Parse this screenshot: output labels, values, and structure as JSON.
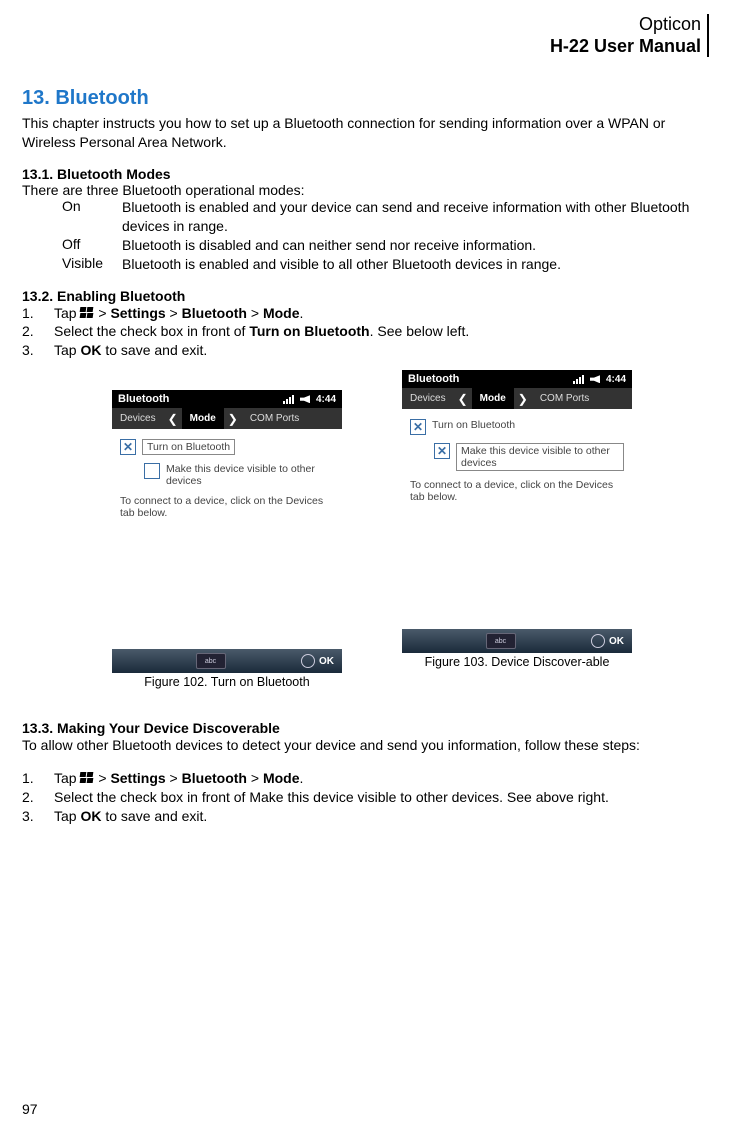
{
  "header": {
    "line1": "Opticon",
    "line2": "H-22 User Manual"
  },
  "chapter": {
    "title": "13. Bluetooth",
    "intro": "This chapter instructs you how to set up a Bluetooth connection for sending information over a WPAN or Wireless Personal Area Network."
  },
  "s1": {
    "head": "13.1. Bluetooth Modes",
    "intro": "There are three Bluetooth operational modes:",
    "modes": [
      {
        "label": "On",
        "desc": "Bluetooth is enabled and your device can send and receive information with other Bluetooth devices in range."
      },
      {
        "label": "Off",
        "desc": "Bluetooth is disabled and can neither send nor receive information."
      },
      {
        "label": "Visible",
        "desc": "Bluetooth is enabled and visible to all other Bluetooth devices in range."
      }
    ]
  },
  "s2": {
    "head": "13.2. Enabling Bluetooth",
    "step1_pre": "Tap ",
    "step1_post_a": " > ",
    "step1_b1": "Settings",
    "step1_post_b": " > ",
    "step1_b2": "Bluetooth",
    "step1_post_c": " > ",
    "step1_b3": "Mode",
    "step1_end": ".",
    "step2_pre": "Select the check box in front of ",
    "step2_b": "Turn on Bluetooth",
    "step2_post": ". See below left.",
    "step3_pre": "Tap ",
    "step3_b": "OK",
    "step3_post": " to save and exit."
  },
  "s3": {
    "head": "13.3. Making Your Device Discoverable",
    "intro": "To allow other Bluetooth devices to detect your device and send you information, follow these steps:",
    "step1_pre": "Tap ",
    "step1_post_a": " > ",
    "step1_b1": "Settings",
    "step1_post_b": " > ",
    "step1_b2": "Bluetooth",
    "step1_post_c": " > ",
    "step1_b3": "Mode",
    "step1_end": ".",
    "step2": "Select the check box in front of Make this device visible to other devices. See above right.",
    "step3_pre": "Tap ",
    "step3_b": "OK",
    "step3_post": " to save and exit."
  },
  "fig1": {
    "caption": "Figure 102. Turn on Bluetooth"
  },
  "fig2": {
    "caption": "Figure 103. Device Discover-able"
  },
  "phone": {
    "title": "Bluetooth",
    "time": "4:44",
    "tabs": {
      "left": "Devices",
      "mid": "Mode",
      "right": "COM Ports"
    },
    "cb1": "Turn on Bluetooth",
    "cb2": "Make this device visible to other devices",
    "help": "To connect to a device, click on the Devices tab below.",
    "soft_mid": "abc",
    "soft_right": "OK"
  },
  "nums": {
    "n1": "1.",
    "n2": "2.",
    "n3": "3."
  },
  "pagenum": "97"
}
